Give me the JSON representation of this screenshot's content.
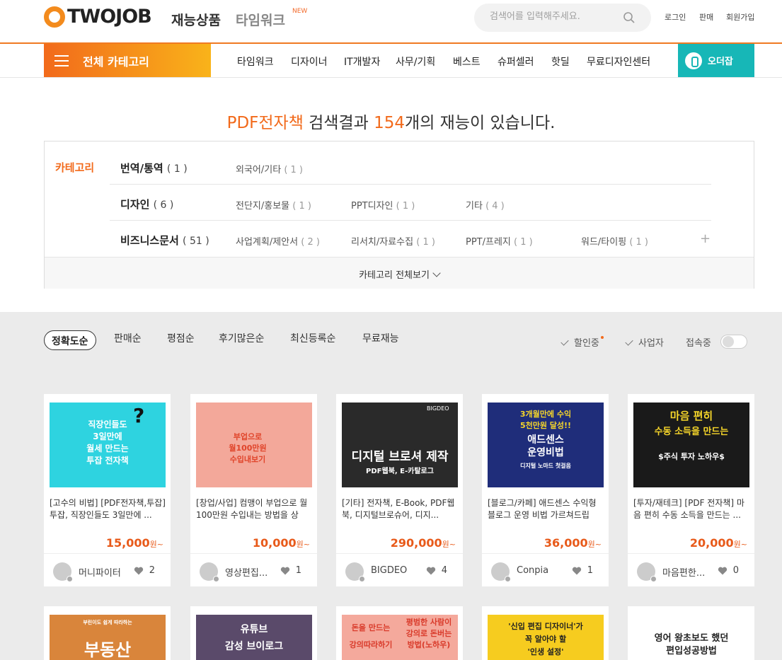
{
  "header": {
    "logo_text": "TWOJOB",
    "nav_main": "재능상품",
    "nav_timework": "타임워크",
    "nav_new": "NEW",
    "search_placeholder": "검색어를 입력해주세요.",
    "login": "로그인",
    "sell": "판매",
    "signup": "회원가입"
  },
  "catbar": {
    "all_categories": "전체 카테고리",
    "items": [
      "타임워크",
      "디자이너",
      "IT개발자",
      "사무/기획",
      "베스트",
      "슈퍼셀러",
      "핫딜",
      "무료디자인센터"
    ],
    "order_label": "오더잡"
  },
  "result": {
    "keyword": "PDF전자책",
    "middle": " 검색결과 ",
    "count": "154",
    "suffix": "개의 재능이 있습니다."
  },
  "filter": {
    "label": "카테고리",
    "rows": [
      {
        "name": "번역/통역",
        "count": "( 1 )",
        "subs": [
          {
            "name": "외국어/기타",
            "count": "( 1 )"
          }
        ]
      },
      {
        "name": "디자인",
        "count": "( 6 )",
        "subs": [
          {
            "name": "전단지/홍보물",
            "count": "( 1 )"
          },
          {
            "name": "PPT디자인",
            "count": "( 1 )"
          },
          {
            "name": "기타",
            "count": "( 4 )"
          }
        ]
      },
      {
        "name": "비즈니스문서",
        "count": "( 51 )",
        "subs": [
          {
            "name": "사업계획/제안서",
            "count": "( 2 )"
          },
          {
            "name": "리서치/자료수집",
            "count": "( 1 )"
          },
          {
            "name": "PPT/프레지",
            "count": "( 1 )"
          },
          {
            "name": "워드/타이핑",
            "count": "( 1 )"
          }
        ]
      }
    ],
    "view_all": "카테고리 전체보기",
    "plus": "+"
  },
  "sort": {
    "active": "정확도순",
    "options": [
      "판매순",
      "평점순",
      "후기많은순",
      "최신등록순",
      "무료재능"
    ],
    "discount": "할인중",
    "business": "사업자",
    "online": "접속중"
  },
  "cards": [
    {
      "title": "[고수의 비법] [PDF전자책,투잡] 투잡, 직장인들도 3일만에 ...",
      "price": "15,000",
      "unit": "원~",
      "seller": "머니파이터",
      "likes": "2",
      "thumb_lines": [
        "직장인들도",
        "3일만에",
        "월세 만드는",
        "투잡 전자책"
      ],
      "mark": "?",
      "colors": {
        "bg": "#2ed3e0",
        "text": "#ffffff"
      }
    },
    {
      "title": "[창업/사업] 컴맹이 부업으로 월100만원 수입내는 방법을 상",
      "price": "10,000",
      "unit": "원~",
      "seller": "영상편집...",
      "likes": "1",
      "thumb_lines": [
        "부업으로",
        "월100만원",
        "수입내보기"
      ],
      "colors": {
        "bg": "#f3a89a",
        "text": "#e0442a"
      }
    },
    {
      "title": "[기타] 전자책, E-Book, PDF웹북, 디지털브로슈어, 디지...",
      "price": "290,000",
      "unit": "원~",
      "seller": "BIGDEO",
      "likes": "4",
      "thumb_lines": [
        "디지털 브로셔 제작",
        "PDF웹북, E-카탈로그"
      ],
      "brand": "BIGDEO",
      "colors": {
        "bg": "#2a2a2a",
        "text": "#ffffff"
      }
    },
    {
      "title": "[블로그/카페] 애드센스 수익형 블로그 운영 비법 가르쳐드립",
      "price": "36,000",
      "unit": "원~",
      "seller": "Conpia",
      "likes": "1",
      "thumb_lines": [
        "3개월만에 수익",
        "5천만원 달성!!",
        "애드센스",
        "운영비법",
        "디지털 노마드 첫걸음"
      ],
      "colors": {
        "bg": "#1f2d7a",
        "text": "#ffffff",
        "accent": "#f6d62a"
      }
    },
    {
      "title": "[투자/재테크] [PDF 전자책] 마음 편히 수동 소득을 만드는 ...",
      "price": "20,000",
      "unit": "원~",
      "seller": "마음편한...",
      "likes": "0",
      "thumb_lines": [
        "마음 편히",
        "수동 소득을 만드는",
        "$주식 투자 노하우$"
      ],
      "colors": {
        "bg": "#1a1a1a",
        "text": "#ffffff",
        "accent": "#f6d62a"
      }
    }
  ],
  "cards_row2": [
    {
      "thumb_lines": [
        "부린이도 쉽게 따라하는",
        "부동산"
      ],
      "colors": {
        "bg": "#d9853b",
        "text": "#ffffff"
      }
    },
    {
      "thumb_lines": [
        "유튜브",
        "감성 브이로그"
      ],
      "colors": {
        "bg": "#5a4a6a",
        "text": "#ffffff"
      }
    },
    {
      "thumb_lines": [
        "돈을 만드는",
        "강의따라하기",
        "평범한 사람이",
        "강의로 돈버는",
        "방법(노하우)"
      ],
      "colors": {
        "bg": "#f4a99c",
        "text": "#d93a2a"
      }
    },
    {
      "thumb_lines": [
        "'신입 편집 디자이너'가",
        "꼭 알아야 할",
        "'인생 설정'"
      ],
      "colors": {
        "bg": "#f6cc1f",
        "text": "#222222"
      }
    },
    {
      "thumb_lines": [
        "영어 왕초보도 했던",
        "편입성공방법"
      ],
      "colors": {
        "bg": "#ffffff",
        "text": "#222222"
      }
    }
  ]
}
